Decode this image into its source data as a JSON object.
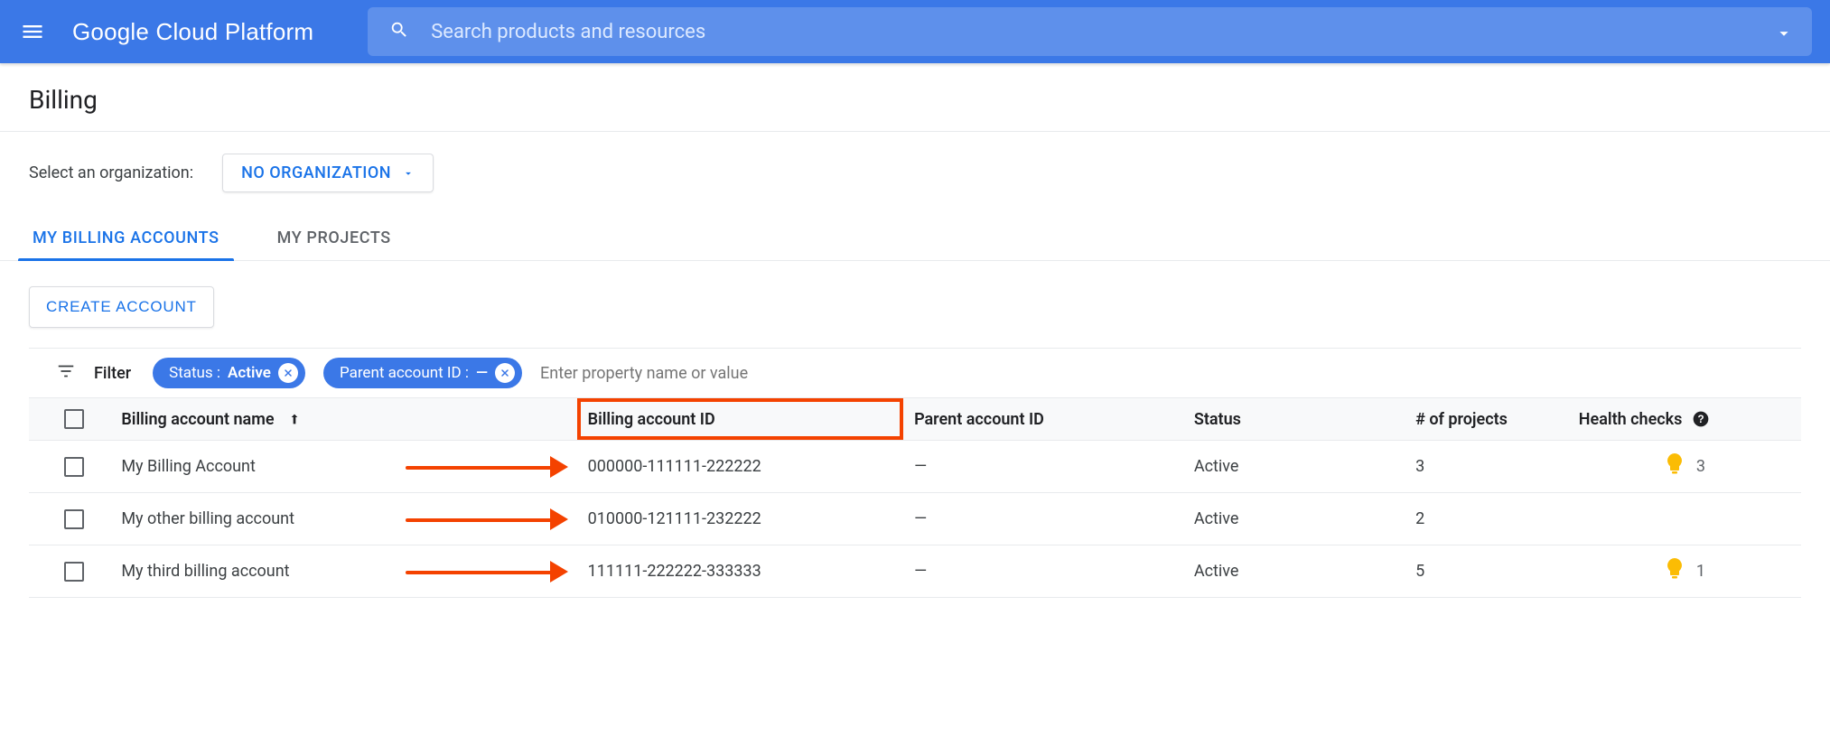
{
  "header": {
    "product": "Google Cloud Platform",
    "search_placeholder": "Search products and resources"
  },
  "page": {
    "title": "Billing",
    "org_label": "Select an organization:",
    "org_value": "NO ORGANIZATION"
  },
  "tabs": {
    "billing": "MY BILLING ACCOUNTS",
    "projects": "MY PROJECTS",
    "active_index": 0
  },
  "actions": {
    "create": "CREATE ACCOUNT"
  },
  "filter": {
    "label": "Filter",
    "chip1_key": "Status : ",
    "chip1_val": "Active",
    "chip2_key": "Parent account ID : ",
    "chip2_val": "—",
    "placeholder": "Enter property name or value"
  },
  "table": {
    "cols": {
      "name": "Billing account name",
      "id": "Billing account ID",
      "parent": "Parent account ID",
      "status": "Status",
      "projects": "# of projects",
      "health": "Health checks"
    },
    "rows": [
      {
        "name": "My Billing Account",
        "id": "000000-111111-222222",
        "parent": "—",
        "status": "Active",
        "projects": "3",
        "health": "3"
      },
      {
        "name": "My other billing account",
        "id": "010000-121111-232222",
        "parent": "—",
        "status": "Active",
        "projects": "2",
        "health": ""
      },
      {
        "name": "My third billing account",
        "id": "111111-222222-333333",
        "parent": "—",
        "status": "Active",
        "projects": "5",
        "health": "1"
      }
    ]
  }
}
